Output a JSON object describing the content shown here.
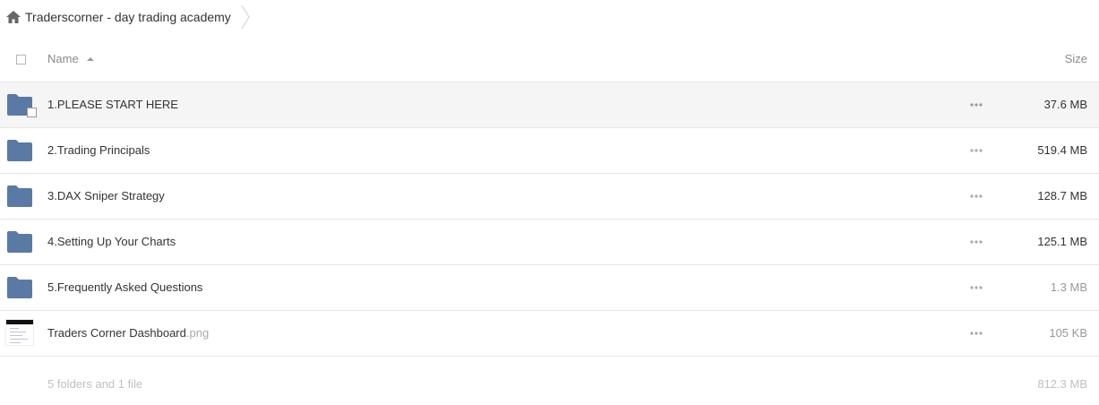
{
  "breadcrumb": {
    "home_icon": "home-icon",
    "folder": "Traderscorner - day trading academy"
  },
  "header": {
    "name_label": "Name",
    "size_label": "Size",
    "sort_icon": "sort-ascending-icon"
  },
  "colors": {
    "folder": "#5a7aa5",
    "row_hover": "#f5f5f5",
    "border": "#e6e6e6"
  },
  "rows": [
    {
      "name": "1.PLEASE START HERE",
      "ext": "",
      "size": "37.6 MB",
      "type": "folder"
    },
    {
      "name": "2.Trading Principals",
      "ext": "",
      "size": "519.4 MB",
      "type": "folder"
    },
    {
      "name": "3.DAX Sniper Strategy",
      "ext": "",
      "size": "128.7 MB",
      "type": "folder"
    },
    {
      "name": "4.Setting Up Your Charts",
      "ext": "",
      "size": "125.1 MB",
      "type": "folder"
    },
    {
      "name": "5.Frequently Asked Questions",
      "ext": "",
      "size": "1.3 MB",
      "type": "folder"
    },
    {
      "name": "Traders Corner Dashboard",
      "ext": ".png",
      "size": "105 KB",
      "type": "image"
    }
  ],
  "footer": {
    "count": "5 folders and 1 file",
    "total": "812.3 MB"
  }
}
